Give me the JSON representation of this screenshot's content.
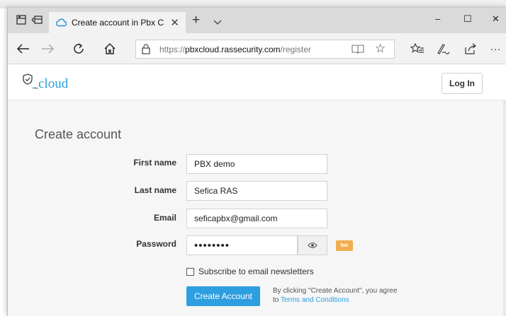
{
  "browser": {
    "tab_title": "Create account in Pbx C",
    "url_prefix": "https://",
    "url_host": "pbxcloud.rassecurity.com",
    "url_path": "/register",
    "window_controls": {
      "minimize": "–",
      "maximize": "☐",
      "close": "✕"
    },
    "more_label": "···"
  },
  "site": {
    "logo_small_text": "PBX",
    "logo_text": "cloud",
    "login_label": "Log In"
  },
  "form": {
    "title": "Create account",
    "first_name_label": "First name",
    "first_name_value": "PBX demo",
    "last_name_label": "Last name",
    "last_name_value": "Sefica RAS",
    "email_label": "Email",
    "email_value": "seficapbx@gmail.com",
    "password_label": "Password",
    "password_value": "••••••••",
    "password_strength": "fair",
    "subscribe_label": "Subscribe to email newsletters",
    "subscribe_checked": false,
    "submit_label": "Create Account",
    "agree_text": "By clicking \"Create Account\", you agree",
    "agree_to": "to ",
    "terms_label": "Terms and Conditions"
  },
  "colors": {
    "accent": "#2d9ee0",
    "logo": "#2a9fd8",
    "strength_fair": "#f0ad4e"
  }
}
